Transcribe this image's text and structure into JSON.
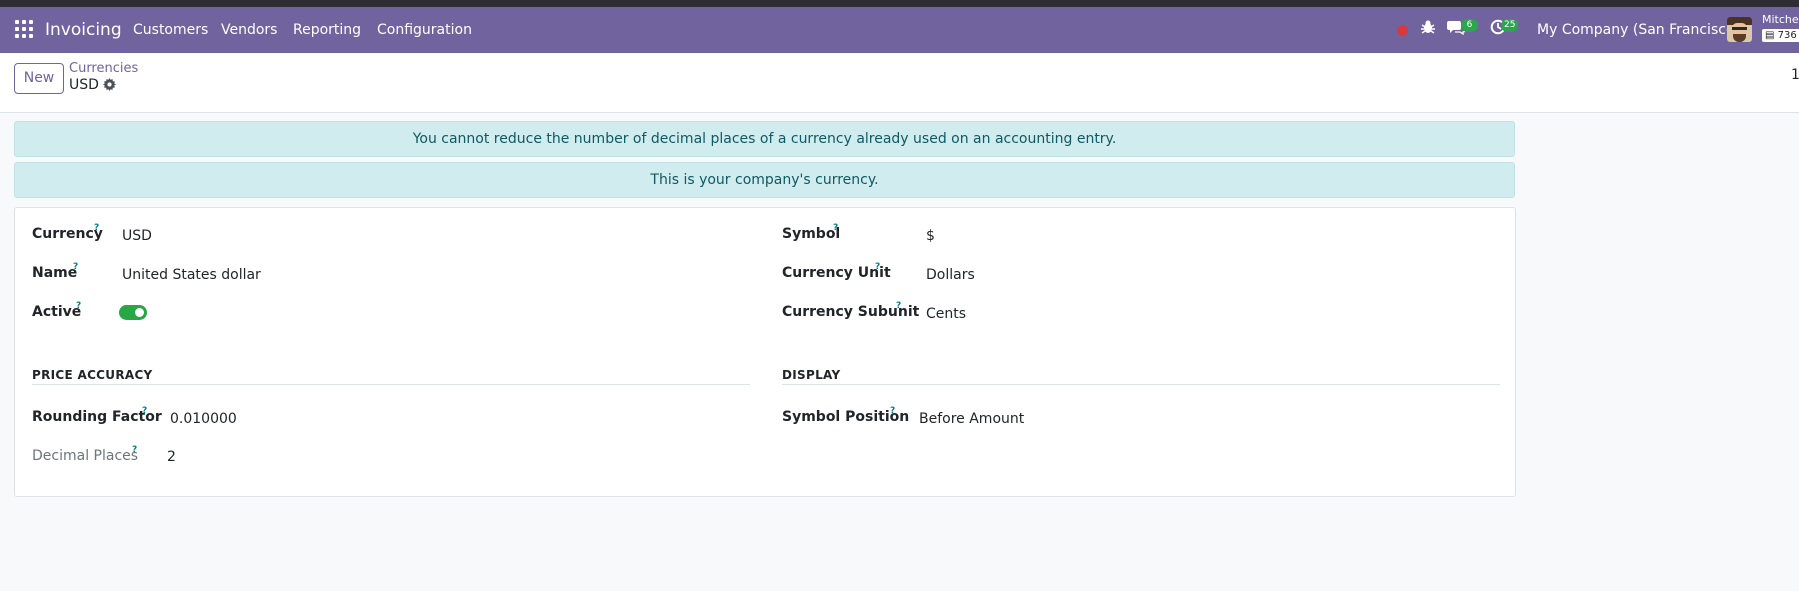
{
  "navbar": {
    "app_name": "Invoicing",
    "menus": [
      "Customers",
      "Vendors",
      "Reporting",
      "Configuration"
    ],
    "messages_count": "6",
    "activities_count": "25",
    "company": "My Company (San Francisco)",
    "user_name": "Mitche",
    "user_db": "736"
  },
  "control": {
    "new_label": "New",
    "breadcrumb_parent": "Currencies",
    "breadcrumb_current": "USD",
    "pager": "1"
  },
  "alerts": [
    "You cannot reduce the number of decimal places of a currency already used on an accounting entry.",
    "This is your company's currency."
  ],
  "form": {
    "help_mark": "?",
    "currency_label": "Currency",
    "currency_value": "USD",
    "name_label": "Name",
    "name_value": "United States dollar",
    "active_label": "Active",
    "active_value": true,
    "symbol_label": "Symbol",
    "symbol_value": "$",
    "unit_label": "Currency Unit",
    "unit_value": "Dollars",
    "subunit_label": "Currency Subunit",
    "subunit_value": "Cents",
    "price_accuracy_title": "PRICE ACCURACY",
    "rounding_label": "Rounding Factor",
    "rounding_value": "0.010000",
    "decimal_label": "Decimal Places",
    "decimal_value": "2",
    "display_title": "DISPLAY",
    "position_label": "Symbol Position",
    "position_value": "Before Amount"
  },
  "colors": {
    "brand": "#71639e",
    "alert_bg": "#d1ecef",
    "toggle_on": "#28a745",
    "badge": "#2da44e",
    "record": "#d9383c"
  }
}
